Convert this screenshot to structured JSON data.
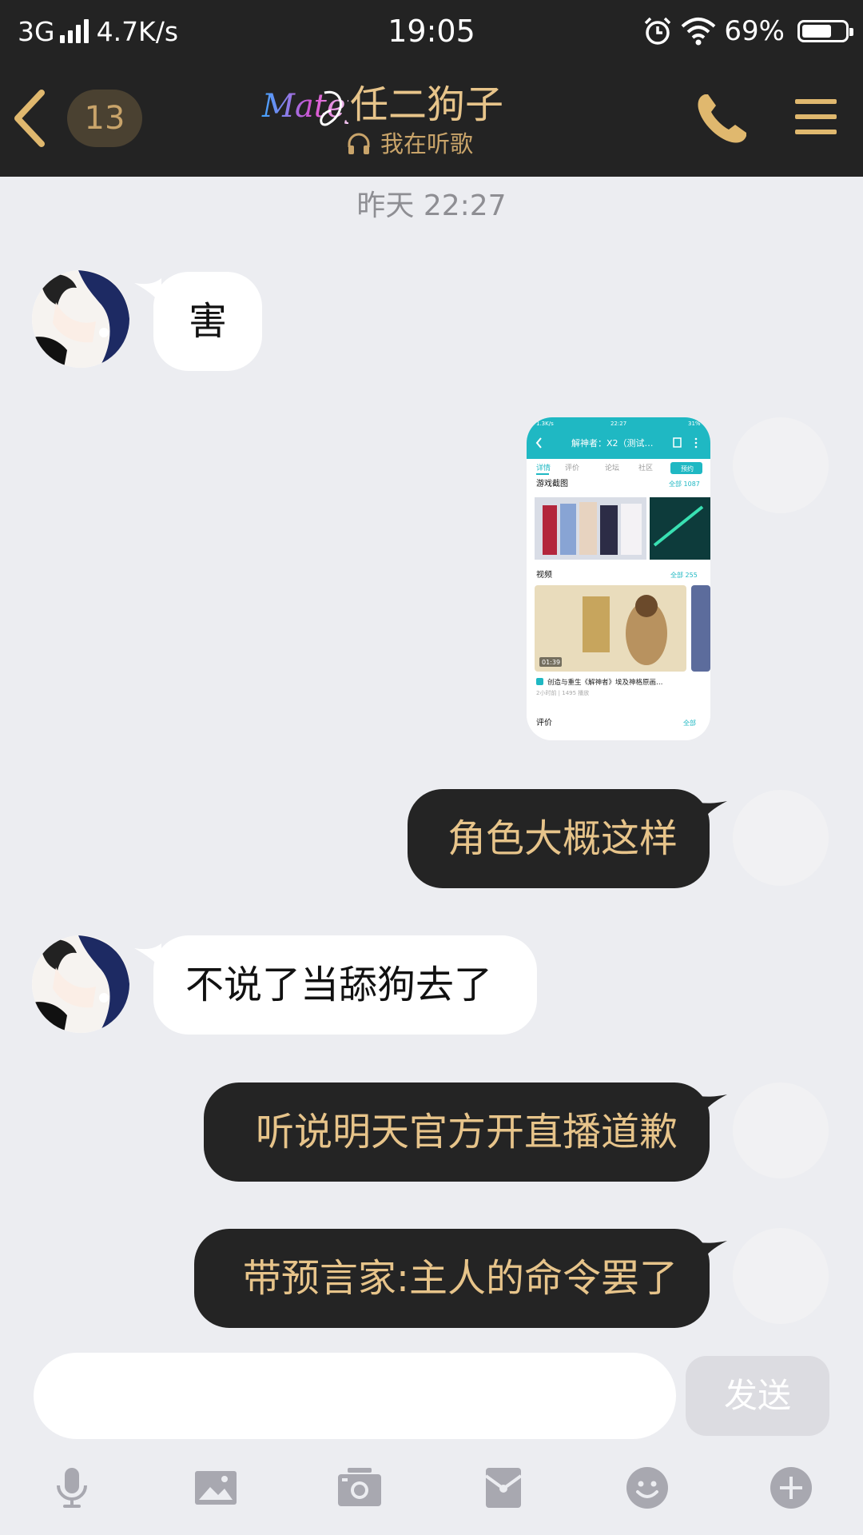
{
  "status_bar": {
    "network": "3G",
    "speed": "4.7K/s",
    "time": "19:05",
    "battery_percent": "69%",
    "battery_level": 0.69
  },
  "nav": {
    "unread_count": "13",
    "logo_text": "Matey",
    "contact_name": "任二狗子",
    "status": "我在听歌"
  },
  "chat": {
    "timestamp": "昨天 22:27",
    "messages": [
      {
        "from": "contact",
        "type": "text",
        "text": "害"
      },
      {
        "from": "me",
        "type": "image"
      },
      {
        "from": "me",
        "type": "text",
        "text": "角色大概这样"
      },
      {
        "from": "contact",
        "type": "text",
        "text": "不说了当舔狗去了"
      },
      {
        "from": "me",
        "type": "text",
        "text": "听说明天官方开直播道歉"
      },
      {
        "from": "me",
        "type": "text",
        "text": "带预言家:主人的命令罢了"
      }
    ]
  },
  "shared_image": {
    "status_time": "22:27",
    "status_left": "1.3K/s",
    "status_right": "31%",
    "title": "解神者：X2（测试…",
    "tabs": [
      "详情",
      "评价",
      "论坛",
      "社区"
    ],
    "tab_counts": [
      "",
      "",
      "",
      ""
    ],
    "action_button": "预约",
    "section_screens": "游戏截图",
    "screens_all": "全部 1087",
    "section_videos": "视频",
    "videos_all": "全部 255",
    "video_duration": "01:39",
    "video_title": "创造与重生《解神者》埃及神格原画…",
    "video_meta": "2小时前 | 1495 播放",
    "section_reviews": "评价",
    "reviews_all": "全部"
  },
  "input": {
    "value": "",
    "placeholder": "",
    "send_label": "发送"
  },
  "toolbar_icons": [
    "mic-icon",
    "image-icon",
    "camera-icon",
    "red-packet-icon",
    "emoji-icon",
    "plus-icon"
  ],
  "colors": {
    "header_bg": "#232323",
    "accent_gold": "#e7c48a",
    "chat_bg": "#ecedf1",
    "bubble_out": "#242424",
    "bubble_in": "#ffffff",
    "teal": "#1fb8c3"
  }
}
